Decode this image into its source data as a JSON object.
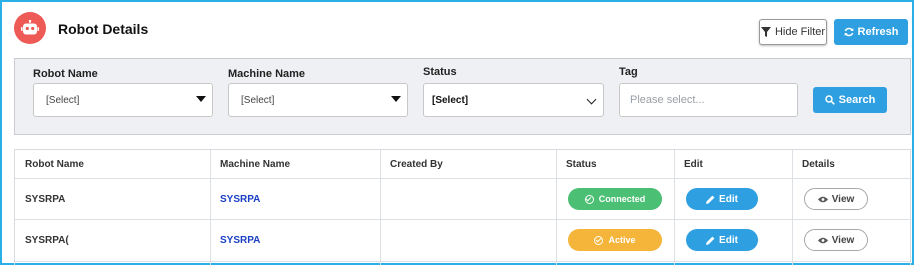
{
  "header": {
    "title": "Robot Details",
    "hide_filter_label": "Hide Filter",
    "refresh_label": "Refresh"
  },
  "filters": {
    "robot_name": {
      "label": "Robot Name",
      "value": "[Select]"
    },
    "machine_name": {
      "label": "Machine Name",
      "value": "[Select]"
    },
    "status": {
      "label": "Status",
      "value": "[Select]"
    },
    "tag": {
      "label": "Tag",
      "placeholder": "Please select..."
    },
    "search_label": "Search"
  },
  "table": {
    "columns": [
      "Robot Name",
      "Machine Name",
      "Created By",
      "Status",
      "Edit",
      "Details"
    ],
    "rows": [
      {
        "robot_name": "SYSRPA",
        "machine_name": "SYSRPA",
        "created_by": "",
        "status": "Connected",
        "edit": "Edit",
        "details": "View"
      },
      {
        "robot_name": "SYSRPA(",
        "machine_name": "SYSRPA",
        "created_by": "",
        "status": "Active",
        "edit": "Edit",
        "details": "View"
      }
    ]
  },
  "colors": {
    "accent": "#2e9fe0",
    "connected": "#4bbf73",
    "active": "#f5b53a",
    "robot_icon": "#ee5a55",
    "frame_border": "#29b0e6"
  },
  "icons": [
    "robot-icon",
    "filter-icon",
    "refresh-icon",
    "search-icon",
    "check-circle-icon",
    "pencil-icon",
    "eye-icon",
    "caret-down-icon",
    "chevron-down-icon"
  ]
}
